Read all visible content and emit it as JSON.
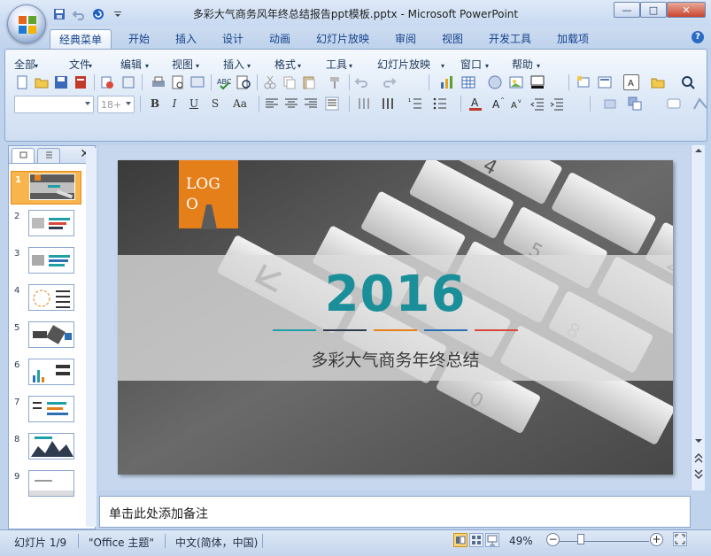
{
  "window": {
    "title": "多彩大气商务风年终总结报告ppt模板.pptx - Microsoft PowerPoint",
    "minimize": "—",
    "maximize": "□",
    "close": "✕"
  },
  "quick_access": {
    "items": [
      "save-icon",
      "undo-icon",
      "redo-icon",
      "customize-icon"
    ]
  },
  "ribbon_tabs": [
    "经典菜单",
    "开始",
    "插入",
    "设计",
    "动画",
    "幻灯片放映",
    "审阅",
    "视图",
    "开发工具",
    "加载项"
  ],
  "active_tab": "经典菜单",
  "help_label": "?",
  "menu": [
    "全部",
    "文件",
    "编辑",
    "视图",
    "插入",
    "格式",
    "工具",
    "幻灯片放映",
    "窗口",
    "帮助"
  ],
  "format_bar": {
    "font_name": "",
    "font_size": "18+",
    "bold": "B",
    "italic": "I",
    "underline": "U",
    "strike": "S",
    "case": "Aa"
  },
  "slide_panel": {
    "close": "✕",
    "thumbnails": [
      "1",
      "2",
      "3",
      "4",
      "5",
      "6",
      "7",
      "8",
      "9"
    ],
    "selected": "1"
  },
  "slide": {
    "logo": "LOGO",
    "year": "2016",
    "subtitle": "多彩大气商务年终总结",
    "accent_colors": [
      "#1fa0a7",
      "#2f3b4f",
      "#e57f1a",
      "#2c6fb5",
      "#d9463a"
    ],
    "keys": [
      "4",
      "2",
      "5",
      "8",
      "0"
    ]
  },
  "notes": {
    "placeholder": "单击此处添加备注"
  },
  "status": {
    "slide_info": "幻灯片 1/9",
    "theme": "\"Office 主题\"",
    "language": "中文(简体，中国)",
    "zoom": "49%"
  }
}
